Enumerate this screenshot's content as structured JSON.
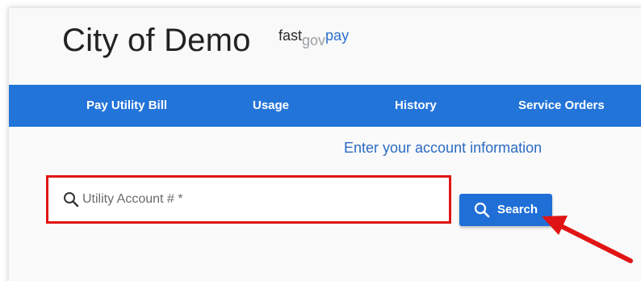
{
  "header": {
    "title": "City of Demo",
    "brand_part1": "fast",
    "brand_part2": "gov",
    "brand_part3": "pay"
  },
  "nav": {
    "items": [
      {
        "label": "Pay Utility Bill"
      },
      {
        "label": "Usage"
      },
      {
        "label": "History"
      },
      {
        "label": "Service Orders"
      }
    ]
  },
  "form": {
    "prompt": "Enter your account information",
    "account_placeholder": "Utility Account # *",
    "account_value": "",
    "search_label": "Search"
  },
  "colors": {
    "nav_bg": "#2374d9",
    "button_bg": "#1f6fd6",
    "highlight_box": "#e01414",
    "annotation_arrow": "#e01414",
    "prompt_text": "#2a6bc4"
  },
  "icons": {
    "input_icon": "search-icon",
    "button_icon": "search-icon",
    "annotation": "red-arrow-icon"
  }
}
